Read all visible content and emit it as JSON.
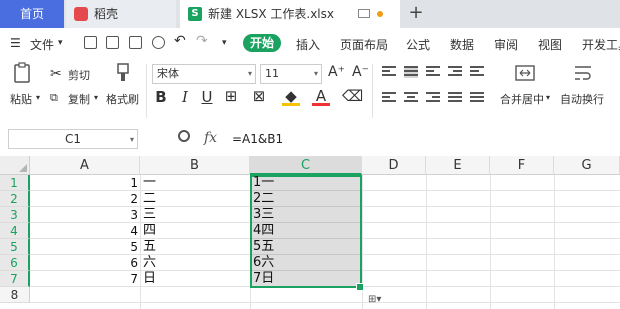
{
  "tabs": {
    "home": "首页",
    "daoke": "稻壳",
    "file": "新建 XLSX 工作表.xlsx",
    "file_icon": "S",
    "add": "+"
  },
  "menu": {
    "file": "文件",
    "start": "开始",
    "items": [
      "插入",
      "页面布局",
      "公式",
      "数据",
      "审阅",
      "视图",
      "开发工具"
    ]
  },
  "ribbon": {
    "paste": "粘贴",
    "cut": "剪切",
    "copy": "复制",
    "format_painter": "格式刷",
    "font_name": "宋体",
    "font_size": "11",
    "merge_center": "合并居中",
    "wrap_text": "自动换行"
  },
  "formula_bar": {
    "name_box": "C1",
    "fx": "fx",
    "formula": "=A1&B1"
  },
  "sheet": {
    "columns": [
      "A",
      "B",
      "C",
      "D",
      "E",
      "F",
      "G"
    ],
    "rows": [
      "1",
      "2",
      "3",
      "4",
      "5",
      "6",
      "7",
      "8"
    ],
    "selected_column": "C",
    "cells": [
      {
        "a": "1",
        "b": "一",
        "c": "1一"
      },
      {
        "a": "2",
        "b": "二",
        "c": "2二"
      },
      {
        "a": "3",
        "b": "三",
        "c": "3三"
      },
      {
        "a": "4",
        "b": "四",
        "c": "4四"
      },
      {
        "a": "5",
        "b": "五",
        "c": "5五"
      },
      {
        "a": "6",
        "b": "六",
        "c": "6六"
      },
      {
        "a": "7",
        "b": "日",
        "c": "7日"
      }
    ]
  },
  "colors": {
    "accent": "#1aa260",
    "home_tab": "#4a6ee0"
  }
}
